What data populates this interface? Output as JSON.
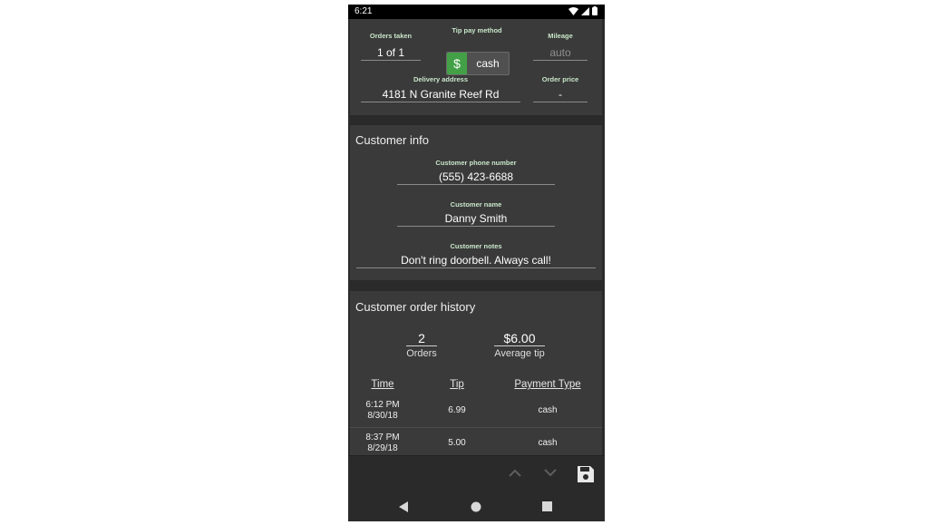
{
  "status_bar": {
    "time": "6:21"
  },
  "order": {
    "orders_taken_label": "Orders taken",
    "orders_taken_value": "1 of 1",
    "tip_method_label": "Tip pay method",
    "tip_method_symbol": "$",
    "tip_method_value": "cash",
    "mileage_label": "Mileage",
    "mileage_placeholder": "auto",
    "delivery_address_label": "Delivery address",
    "delivery_address_value": "4181 N Granite Reef Rd",
    "order_price_label": "Order price",
    "order_price_value": "-"
  },
  "customer_info": {
    "title": "Customer info",
    "phone_label": "Customer phone number",
    "phone_value": "(555) 423-6688",
    "name_label": "Customer name",
    "name_value": "Danny Smith",
    "notes_label": "Customer notes",
    "notes_value": "Don't ring doorbell. Always call!"
  },
  "order_history": {
    "title": "Customer order history",
    "orders_count": "2",
    "orders_label": "Orders",
    "average_tip": "$6.00",
    "average_tip_label": "Average tip",
    "columns": [
      "Time",
      "Tip",
      "Payment Type"
    ],
    "rows": [
      {
        "time": "6:12 PM",
        "date": "8/30/18",
        "tip": "6.99",
        "payment": "cash"
      },
      {
        "time": "8:37 PM",
        "date": "8/29/18",
        "tip": "5.00",
        "payment": "cash"
      }
    ]
  },
  "toolbar": {
    "icons": [
      "chevron-up-icon",
      "chevron-down-icon",
      "save-icon"
    ]
  },
  "navbar": {
    "icons": [
      "back-icon",
      "home-icon",
      "recents-icon"
    ]
  },
  "colors": {
    "accent_green": "#43a047",
    "label_green": "#c8e6c9",
    "card_bg": "#3a3a3a",
    "screen_bg": "#2a2a2a"
  }
}
